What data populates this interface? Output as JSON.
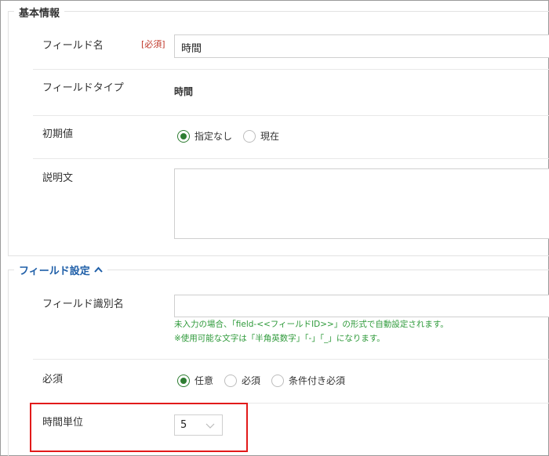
{
  "sections": {
    "basic": {
      "title": "基本情報"
    },
    "field_settings": {
      "title": "フィールド設定",
      "toggle_icon": "chevron-up-icon",
      "title_color": "#1f5fa8"
    }
  },
  "basic_fields": {
    "field_name": {
      "label": "フィールド名",
      "required_tag": "[必須]",
      "value": "時間"
    },
    "field_type": {
      "label": "フィールドタイプ",
      "value": "時間"
    },
    "initial_value": {
      "label": "初期値",
      "options": [
        {
          "label": "指定なし",
          "checked": true
        },
        {
          "label": "現在",
          "checked": false
        }
      ]
    },
    "description": {
      "label": "説明文",
      "value": ""
    }
  },
  "settings_fields": {
    "identifier": {
      "label": "フィールド識別名",
      "value": "",
      "hint_line1": "未入力の場合、「field-<<フィールドID>>」の形式で自動設定されます。",
      "hint_line2": "※使用可能な文字は「半角英数字」「-」「_」になります。"
    },
    "required": {
      "label": "必須",
      "options": [
        {
          "label": "任意",
          "checked": true
        },
        {
          "label": "必須",
          "checked": false
        },
        {
          "label": "条件付き必須",
          "checked": false
        }
      ]
    },
    "time_unit": {
      "label": "時間単位",
      "value": "5"
    }
  },
  "colors": {
    "accent_green": "#2e7d32",
    "highlight_red": "#e21a1a",
    "hint_green": "#2e9a3a"
  }
}
